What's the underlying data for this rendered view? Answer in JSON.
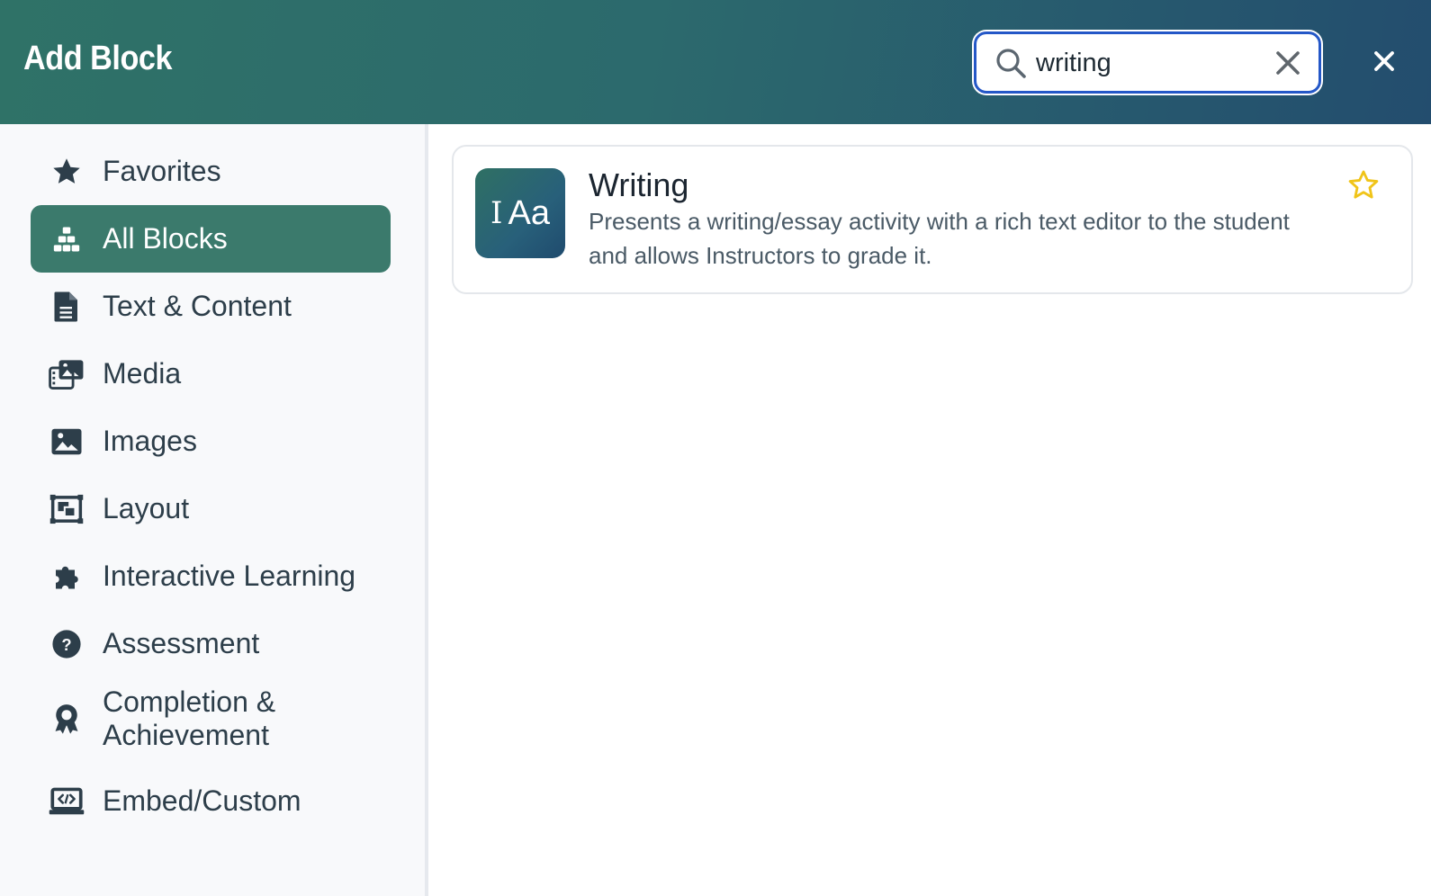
{
  "header": {
    "title": "Add Block",
    "search": {
      "value": "writing",
      "placeholder": "Search"
    }
  },
  "sidebar": {
    "items": [
      {
        "label": "Favorites",
        "icon": "star-icon",
        "active": false
      },
      {
        "label": "All Blocks",
        "icon": "blocks-icon",
        "active": true
      },
      {
        "label": "Text & Content",
        "icon": "document-icon",
        "active": false
      },
      {
        "label": "Media",
        "icon": "media-icon",
        "active": false
      },
      {
        "label": "Images",
        "icon": "image-icon",
        "active": false
      },
      {
        "label": "Layout",
        "icon": "layout-icon",
        "active": false
      },
      {
        "label": "Interactive Learning",
        "icon": "puzzle-icon",
        "active": false
      },
      {
        "label": "Assessment",
        "icon": "question-circle-icon",
        "active": false
      },
      {
        "label_line1": "Completion &",
        "label_line2": "Achievement",
        "icon": "award-icon",
        "active": false
      },
      {
        "label": "Embed/Custom",
        "icon": "code-laptop-icon",
        "active": false
      }
    ]
  },
  "results": [
    {
      "title": "Writing",
      "thumb_text": "Aa",
      "description": "Presents a writing/essay activity with a rich text editor to the student and allows Instructors to grade it.",
      "favorite": false
    }
  ],
  "colors": {
    "header_start": "#2f7267",
    "header_end": "#234d6e",
    "active_nav": "#3b7a6c",
    "search_border": "#2457c7",
    "star": "#f0c419",
    "text": "#2d3e4a"
  }
}
